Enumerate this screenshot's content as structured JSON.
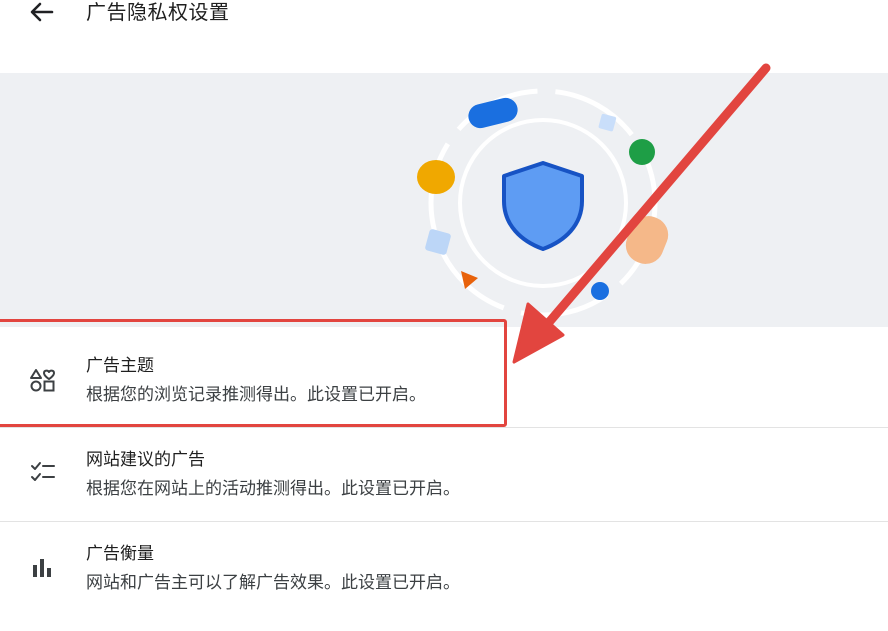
{
  "header": {
    "title": "广告隐私权设置",
    "back_icon": "arrow-left-icon"
  },
  "hero": {
    "illustration": "shield-icon",
    "colors": {
      "background": "#eef0f3",
      "shield_fill": "#5e9cf3",
      "shield_stroke": "#1753c4",
      "blue": "#1a6fe0",
      "yellow": "#f0a800",
      "green": "#1e9e46",
      "peach": "#f5b889",
      "light_blue": "#bcd6f7",
      "orange": "#e8620b"
    }
  },
  "settings": [
    {
      "title": "广告主题",
      "description": "根据您的浏览记录推测得出。此设置已开启。",
      "icon": "topics-shapes-icon"
    },
    {
      "title": "网站建议的广告",
      "description": "根据您在网站上的活动推测得出。此设置已开启。",
      "icon": "checklist-icon"
    },
    {
      "title": "广告衡量",
      "description": "网站和广告主可以了解广告效果。此设置已开启。",
      "icon": "bar-chart-icon"
    }
  ],
  "annotation": {
    "color": "#e2453f"
  }
}
